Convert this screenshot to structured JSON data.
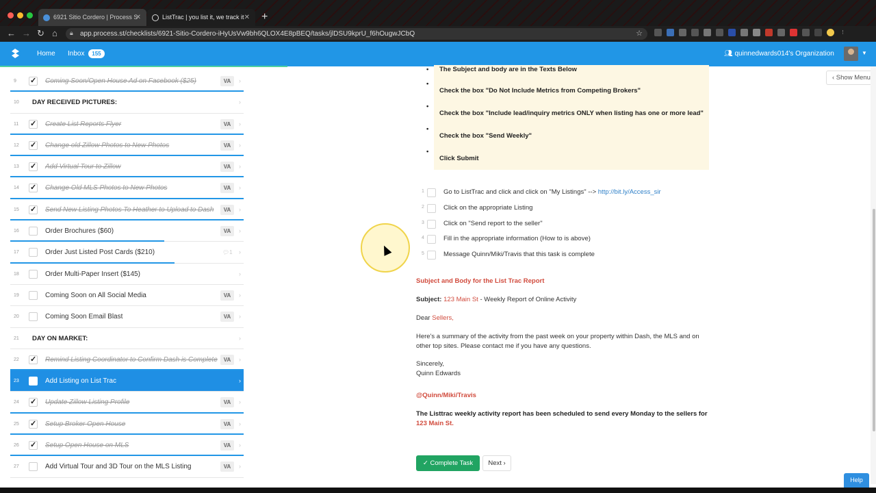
{
  "browser": {
    "tabs": [
      {
        "title": "6921 Sitio Cordero | Process S"
      },
      {
        "title": "ListTrac | you list it, we track it"
      }
    ],
    "url": "app.process.st/checklists/6921-Sitio-Cordero-iHyUsVw9bh6QLOX4E8pBEQ/tasks/jlDSU9kprU_f6hOugwJCbQ"
  },
  "header": {
    "home_label": "Home",
    "inbox_label": "Inbox",
    "inbox_count": "155",
    "organization": "quinnedwards014's Organization"
  },
  "tasks": [
    {
      "num": "9",
      "name": "Coming Soon/Open House Ad on Facebook ($25)",
      "done": true,
      "va": "VA",
      "type": "task"
    },
    {
      "num": "10",
      "name": "DAY RECEIVED PICTURES:",
      "type": "heading"
    },
    {
      "num": "11",
      "name": "Create List Reports Flyer",
      "done": true,
      "va": "VA",
      "type": "task"
    },
    {
      "num": "12",
      "name": "Change old Zillow Photos to New Photos",
      "done": true,
      "va": "VA",
      "type": "task"
    },
    {
      "num": "13",
      "name": "Add Virtual Tour to Zillow",
      "done": true,
      "va": "VA",
      "type": "task"
    },
    {
      "num": "14",
      "name": "Change Old MLS Photos to New Photos",
      "done": true,
      "va": "VA",
      "type": "task"
    },
    {
      "num": "15",
      "name": "Send New Listing Photos To Heather to Upload to Dash",
      "done": true,
      "va": "VA",
      "type": "task"
    },
    {
      "num": "16",
      "name": "Order Brochures ($60)",
      "done": false,
      "va": "VA",
      "type": "task"
    },
    {
      "num": "17",
      "name": "Order Just Listed Post Cards ($210)",
      "done": false,
      "comments": "1",
      "type": "task"
    },
    {
      "num": "18",
      "name": "Order Multi-Paper Insert ($145)",
      "done": false,
      "type": "task"
    },
    {
      "num": "19",
      "name": "Coming Soon on All Social Media",
      "done": false,
      "va": "VA",
      "type": "task"
    },
    {
      "num": "20",
      "name": "Coming Soon Email Blast",
      "done": false,
      "va": "VA",
      "type": "task"
    },
    {
      "num": "21",
      "name": "DAY ON MARKET:",
      "type": "heading"
    },
    {
      "num": "22",
      "name": "Remind Listing Coordinator to Confirm Dash is Complete",
      "done": true,
      "va": "VA",
      "type": "task"
    },
    {
      "num": "23",
      "name": "Add Listing on List Trac",
      "done": false,
      "active": true,
      "type": "task"
    },
    {
      "num": "24",
      "name": "Update Zillow Listing Profile",
      "done": true,
      "va": "VA",
      "type": "task"
    },
    {
      "num": "25",
      "name": "Setup Broker Open House",
      "done": true,
      "va": "VA",
      "type": "task"
    },
    {
      "num": "26",
      "name": "Setup Open House on MLS",
      "done": true,
      "va": "VA",
      "type": "task"
    },
    {
      "num": "27",
      "name": "Add Virtual Tour and 3D Tour on the MLS Listing",
      "done": false,
      "va": "VA",
      "type": "task"
    }
  ],
  "content": {
    "yellow_bullets": [
      "The Subject and body are in the Texts Below",
      "Check the box \"Do Not Include Metrics from Competing Brokers\"",
      "Check the box \"Include lead/inquiry metrics ONLY when listing has one or more lead\"",
      "Check the box \"Send Weekly\"",
      "Click Submit"
    ],
    "steps": [
      {
        "num": "1",
        "text": "Go to ListTrac and click and click on \"My Listings\" -->",
        "link": "http://bit.ly/Access_sir"
      },
      {
        "num": "2",
        "text": "Click on the appropriate Listing"
      },
      {
        "num": "3",
        "text": "Click on \"Send report to the seller\""
      },
      {
        "num": "4",
        "text": "Fill in the appropriate information (How to is above)"
      },
      {
        "num": "5",
        "text": "Message Quinn/Miki/Travis that this task is complete"
      }
    ],
    "report_heading": "Subject and Body for the List Trac Report",
    "subject_label": "Subject:",
    "subject_address": "123 Main St",
    "subject_rest": " - Weekly Report of Online Activity",
    "dear": "Dear ",
    "dear_name": "Sellers,",
    "summary": "Here's a summary of the activity from the past week on your property within Dash, the MLS and on other top sites. Please contact me if you have any questions.",
    "sincerely": "Sincerely,",
    "signature": "Quinn Edwards",
    "mention": "@Quinn/Miki/Travis",
    "schedule_text": "The Listtrac weekly activity report has been scheduled to send every Monday to the sellers for ",
    "schedule_address": "123 Main St."
  },
  "buttons": {
    "complete": "✓ Complete Task",
    "next": "Next ›",
    "show_menu": "‹ Show Menu",
    "help": "Help"
  },
  "colors": {
    "brand_blue": "#2196e6",
    "complete_green": "#21a462",
    "accent_red": "#d14b3d"
  }
}
